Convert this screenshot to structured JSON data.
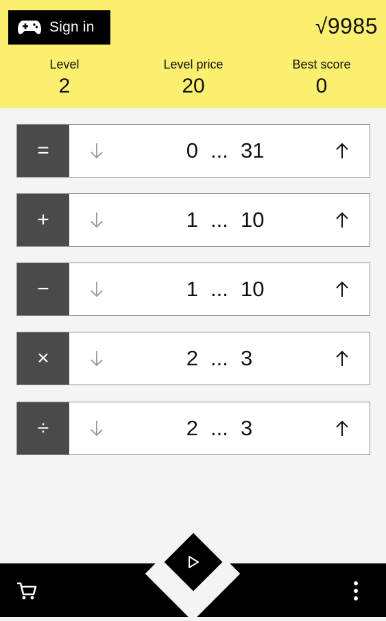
{
  "header": {
    "sign_in_label": "Sign in",
    "balance": "√9985",
    "stats": [
      {
        "label": "Level",
        "value": "2"
      },
      {
        "label": "Level price",
        "value": "20"
      },
      {
        "label": "Best score",
        "value": "0"
      }
    ]
  },
  "ranges": [
    {
      "operator": "=",
      "name": "equals",
      "min": "0",
      "max": "31"
    },
    {
      "operator": "+",
      "name": "plus",
      "min": "1",
      "max": "10"
    },
    {
      "operator": "−",
      "name": "minus",
      "min": "1",
      "max": "10"
    },
    {
      "operator": "×",
      "name": "multiply",
      "min": "2",
      "max": "3"
    },
    {
      "operator": "÷",
      "name": "divide",
      "min": "2",
      "max": "3"
    }
  ],
  "range_separator": "...",
  "icons": {
    "sign_in": "gamepad-icon",
    "decrease": "arrow-down-icon",
    "increase": "arrow-up-icon",
    "play": "play-icon",
    "shop": "cart-icon",
    "menu": "more-vert-icon"
  },
  "colors": {
    "header_bg": "#fbef6f",
    "operator_bg": "#4a4a4a",
    "disabled_arrow": "#9e9e9e",
    "footer_bg": "#000000"
  }
}
